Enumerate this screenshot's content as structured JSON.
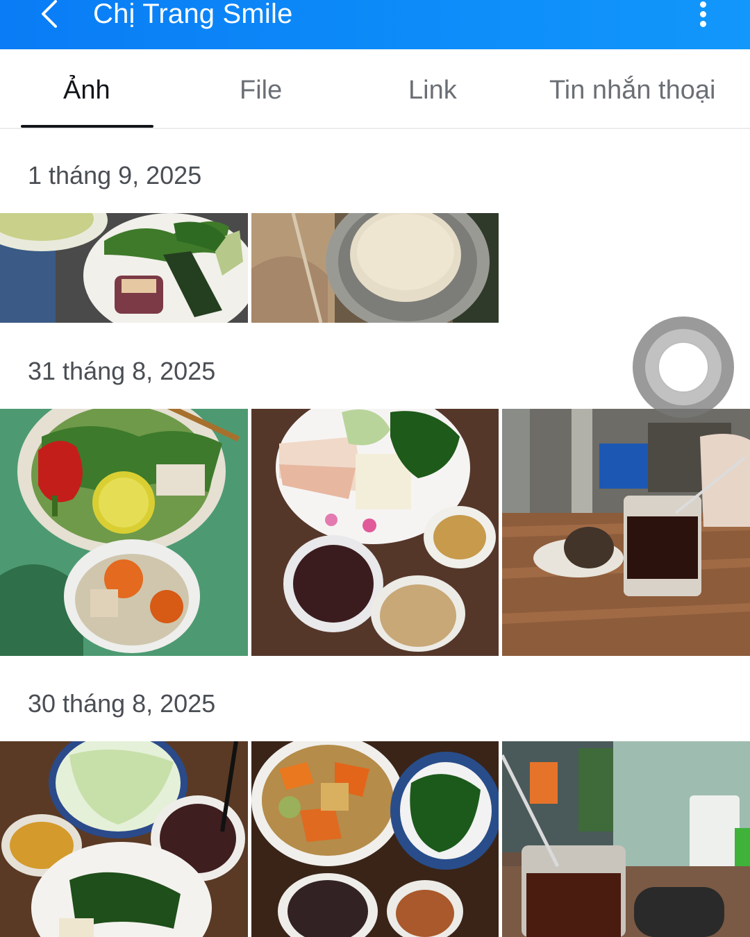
{
  "header": {
    "title": "Chị Trang Smile",
    "accent_color": "#0a84f7",
    "back_icon": "chevron-left-icon",
    "menu_icon": "more-vertical-icon"
  },
  "tabs": [
    {
      "label": "Ảnh",
      "active": true
    },
    {
      "label": "File",
      "active": false
    },
    {
      "label": "Link",
      "active": false
    },
    {
      "label": "Tin nhắn thoại",
      "active": false
    }
  ],
  "sections": [
    {
      "date": "1 tháng 9, 2025",
      "photo_count": 2
    },
    {
      "date": "31 tháng 8, 2025",
      "photo_count": 3
    },
    {
      "date": "30 tháng 8, 2025",
      "photo_count": 3
    }
  ]
}
